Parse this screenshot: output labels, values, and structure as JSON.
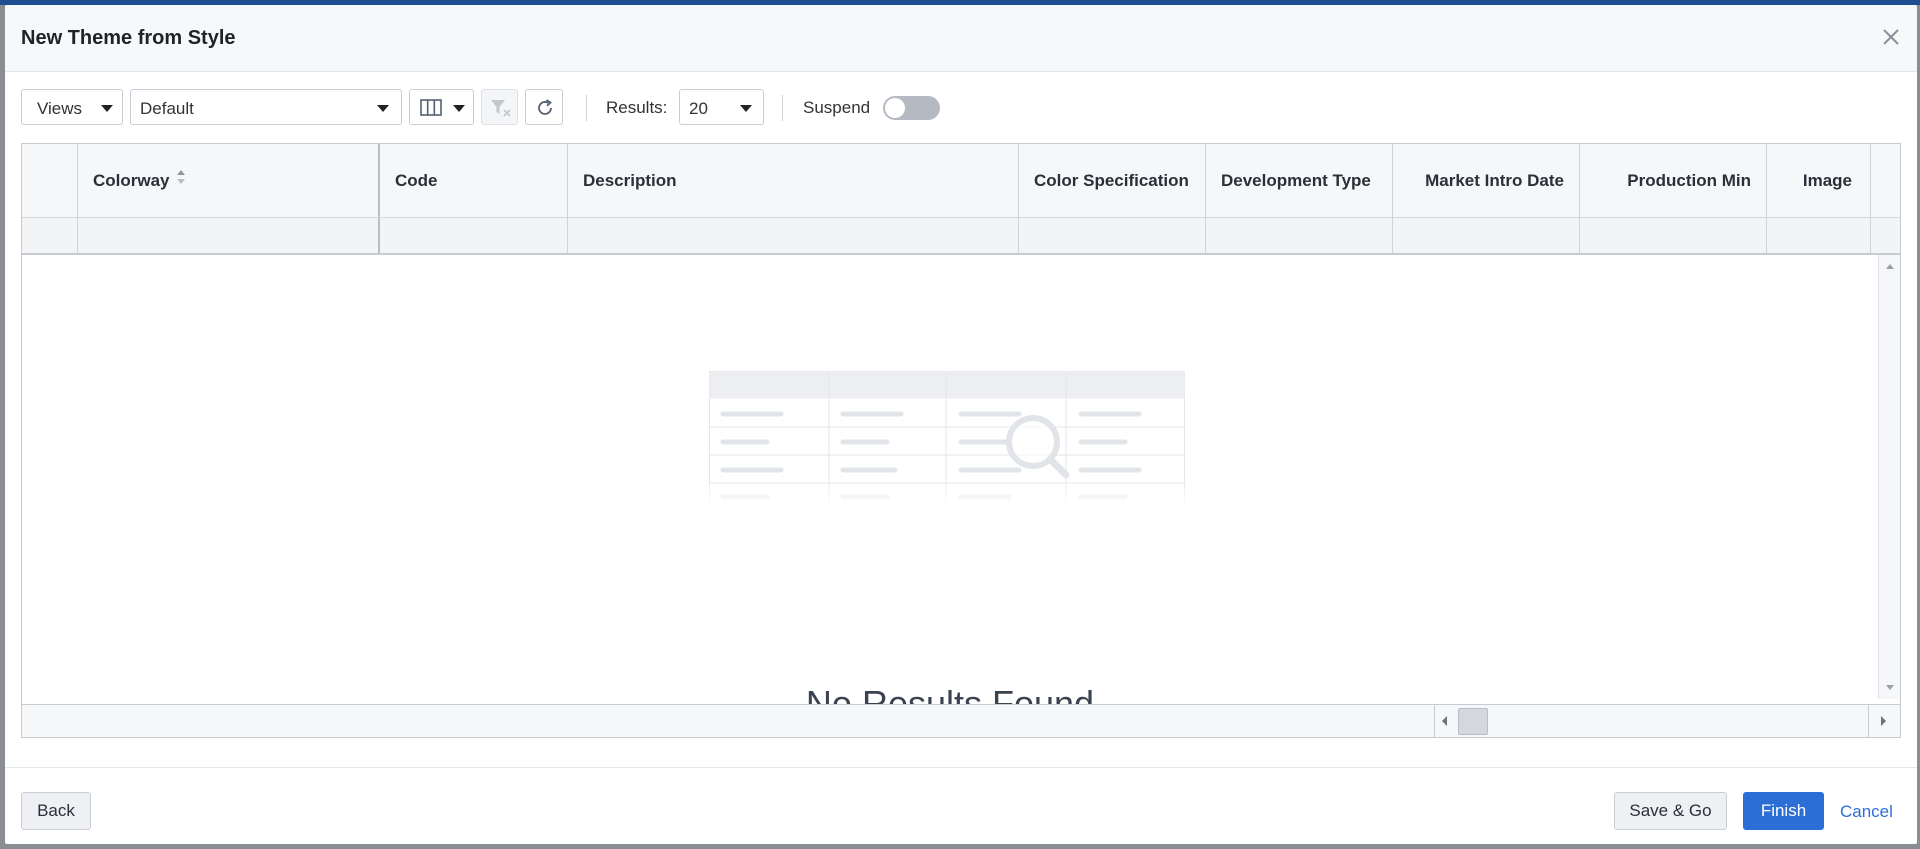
{
  "dialog": {
    "title": "New Theme from Style"
  },
  "toolbar": {
    "views_label": "Views",
    "view_selected": "Default",
    "results_label": "Results:",
    "results_value": "20",
    "suspend_label": "Suspend",
    "suspend_on": false
  },
  "grid": {
    "columns": [
      {
        "label": "Colorway",
        "sortable": true
      },
      {
        "label": "Code"
      },
      {
        "label": "Description"
      },
      {
        "label": "Color Specification"
      },
      {
        "label": "Development Type"
      },
      {
        "label": "Market Intro Date"
      },
      {
        "label": "Production Min"
      },
      {
        "label": "Image"
      }
    ],
    "empty_message": "No Results Found"
  },
  "footer": {
    "back_label": "Back",
    "save_go_label": "Save & Go",
    "finish_label": "Finish",
    "cancel_label": "Cancel"
  },
  "colors": {
    "primary": "#2b6fd6",
    "header_bg": "#f7f8fa",
    "top_bar": "#1d4f91"
  }
}
